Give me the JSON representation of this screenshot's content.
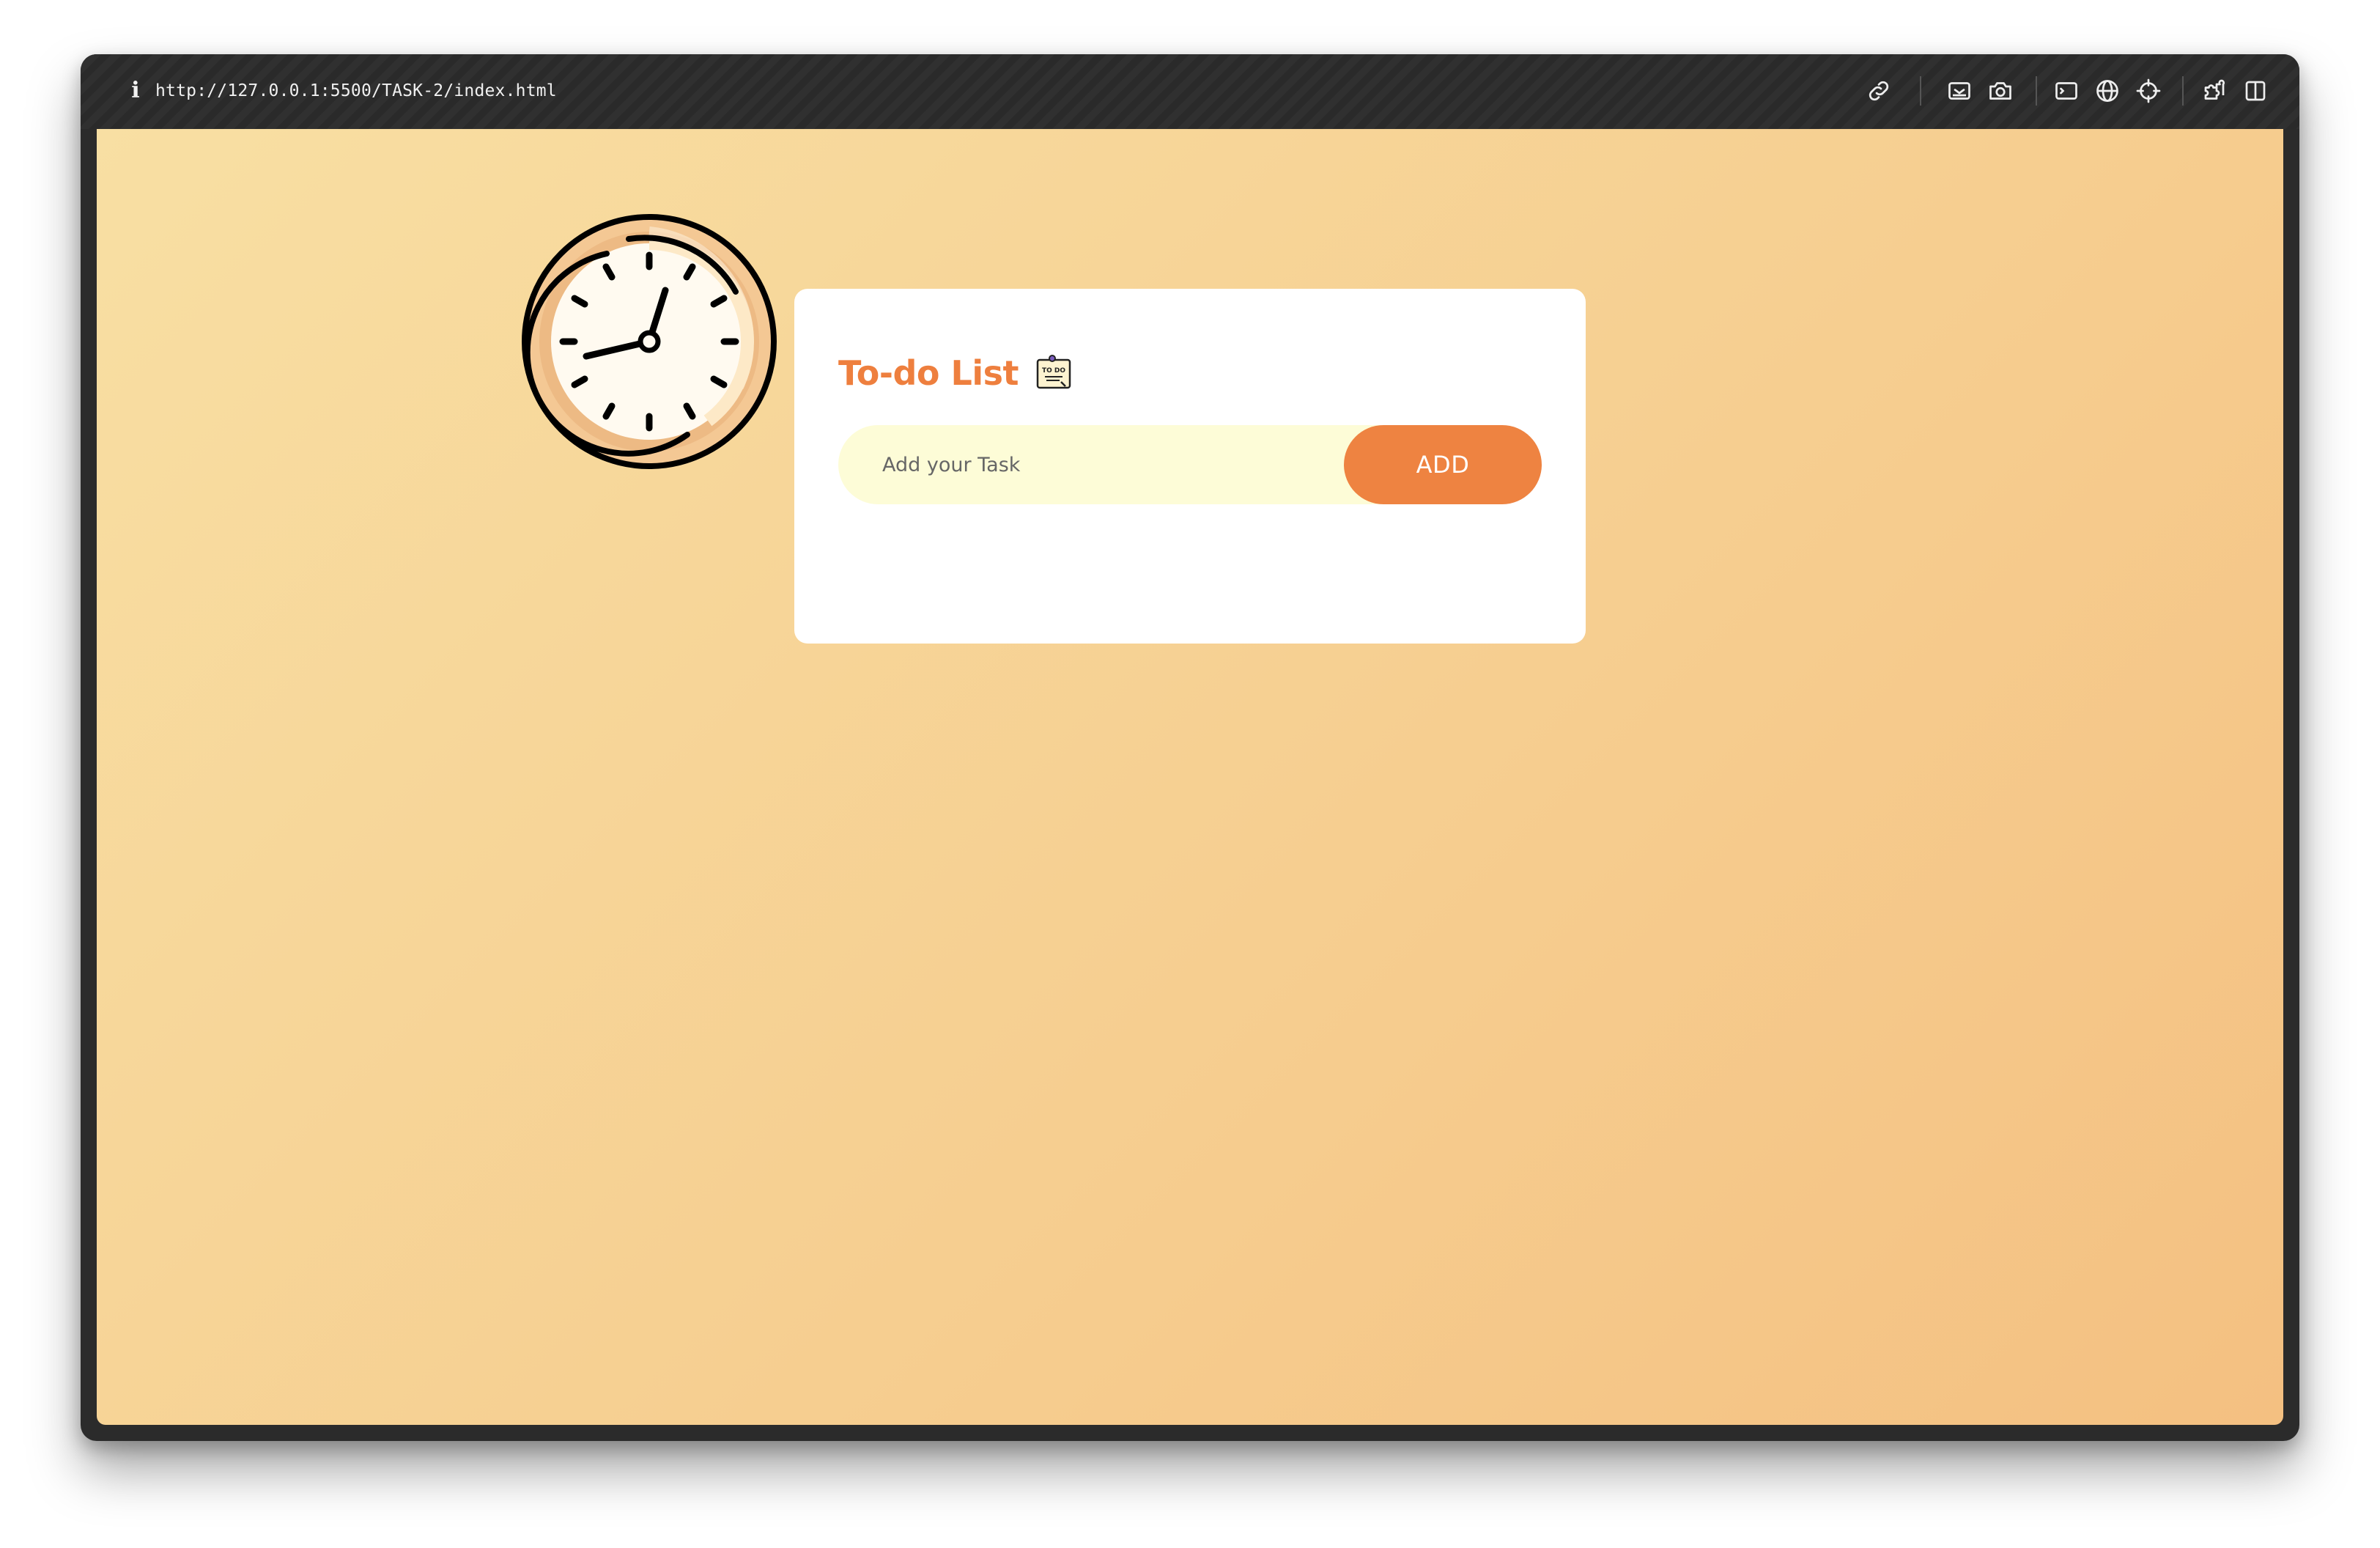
{
  "browser": {
    "url": "http://127.0.0.1:5500/TASK-2/index.html",
    "info_icon": "i",
    "toolbar_icons": [
      "link-icon",
      "screenshot-icon",
      "camera-icon",
      "terminal-icon",
      "globe-icon",
      "crosshair-icon",
      "extensions-icon",
      "sidebar-icon"
    ]
  },
  "app": {
    "title": "To-do List",
    "title_icon": "todo-note-icon",
    "input_placeholder": "Add your Task",
    "add_button_label": "ADD",
    "tasks": []
  },
  "colors": {
    "accent": "#ee8341",
    "title": "#ee7f3e",
    "input_bg": "#fdfcd7",
    "background_start": "#f8dfa3",
    "background_end": "#f4c081"
  }
}
